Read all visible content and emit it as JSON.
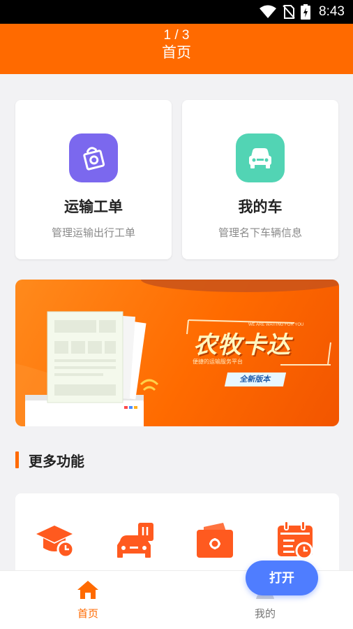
{
  "status_bar": {
    "time": "8:43",
    "icons": [
      "wifi-icon",
      "no-sim-icon",
      "battery-charging-icon"
    ]
  },
  "header": {
    "pager": "1 / 3",
    "title": "首页"
  },
  "cards": [
    {
      "title": "运输工单",
      "subtitle": "管理运输出行工单",
      "icon": "shopping-bag-icon",
      "color": "#7b68ee"
    },
    {
      "title": "我的车",
      "subtitle": "管理名下车辆信息",
      "icon": "car-icon",
      "color": "#52d4b4"
    }
  ],
  "banner": {
    "title": "农牧卡达",
    "tag": "全新版本",
    "small_text": "WE ARE WAITING FOR YOU",
    "sub_text": "便捷的运输服务平台"
  },
  "section": {
    "title": "更多功能"
  },
  "features": [
    {
      "icon": "graduation-cap-icon"
    },
    {
      "icon": "car-service-icon"
    },
    {
      "icon": "wallet-icon"
    },
    {
      "icon": "calendar-icon"
    }
  ],
  "bottom_nav": {
    "home_label": "首页",
    "mine_label": "我的",
    "open_label": "打开"
  },
  "colors": {
    "accent": "#ff6a00",
    "button_blue": "#4f7dff"
  }
}
